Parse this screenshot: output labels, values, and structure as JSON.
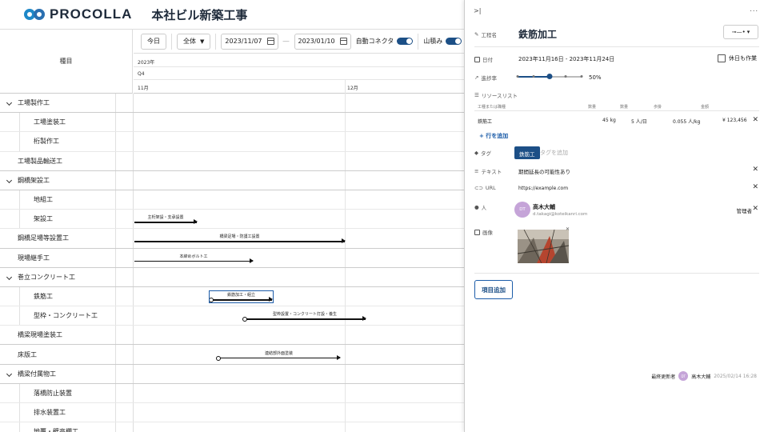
{
  "header": {
    "logo_text": "PROCOLLA",
    "project_title": "本社ビル新築工事"
  },
  "gantt": {
    "column_header": "種目",
    "toolbar": {
      "today": "今日",
      "scope": "全体",
      "start_date": "2023/11/07",
      "end_date": "2023/01/10",
      "auto_connector": "自動コネクタ",
      "stacking": "山積み"
    },
    "timeline": {
      "year": "2023年",
      "quarter": "Q4",
      "months": [
        "11月",
        "12月"
      ]
    },
    "rows": [
      {
        "label": "工場製作工",
        "kind": "parent"
      },
      {
        "label": "工場塗装工",
        "kind": "child"
      },
      {
        "label": "桁製作工",
        "kind": "child"
      },
      {
        "label": "工場製品輸送工",
        "kind": "plain"
      },
      {
        "label": "鋼橋架設工",
        "kind": "parent"
      },
      {
        "label": "地組工",
        "kind": "child"
      },
      {
        "label": "架設工",
        "kind": "child"
      },
      {
        "label": "鋼橋足場等設置工",
        "kind": "plain"
      },
      {
        "label": "現場継手工",
        "kind": "plain"
      },
      {
        "label": "巻立コンクリート工",
        "kind": "parent"
      },
      {
        "label": "鉄筋工",
        "kind": "child"
      },
      {
        "label": "型枠・コンクリート工",
        "kind": "child"
      },
      {
        "label": "橋梁現場塗装工",
        "kind": "plain"
      },
      {
        "label": "床版工",
        "kind": "plain"
      },
      {
        "label": "橋梁付属物工",
        "kind": "parent"
      },
      {
        "label": "落橋防止装置",
        "kind": "child"
      },
      {
        "label": "排水装置工",
        "kind": "child"
      },
      {
        "label": "地覆・壁高欄工",
        "kind": "child"
      }
    ],
    "bars": [
      {
        "row": 6,
        "label": "主桁架設・支承設置"
      },
      {
        "row": 7,
        "label": "橋梁足場・防護工設置"
      },
      {
        "row": 8,
        "label": "本締めボルト工"
      },
      {
        "row": 10,
        "label": "鉄筋加工・組立"
      },
      {
        "row": 11,
        "label": "型枠設置・コンクリート打設・養生"
      },
      {
        "row": 13,
        "label": "連結部外面塗装"
      }
    ]
  },
  "panel": {
    "name_label": "工程名",
    "name_value": "鉄筋加工",
    "date_label": "日付",
    "date_value": "2023年11月16日 - 2023年11月24日",
    "holiday_label": "休日も作業",
    "progress_label": "進捗率",
    "progress_value": "50%",
    "progress_fraction": 0.5,
    "resource_label": "リソースリスト",
    "resource_headers": [
      "工種または職種",
      "数量",
      "数量",
      "歩掛",
      "金額"
    ],
    "resource_row": [
      "鉄筋工",
      "45 kg",
      "5 人/日",
      "0.055 人/kg",
      "¥ 123,456"
    ],
    "add_row": "+ 行を追加",
    "tag_label": "タグ",
    "tag_value": "鉄筋工",
    "tag_placeholder": "タグを追加",
    "text_label": "テキスト",
    "text_value": "期間延長の可能性あり",
    "url_label": "URL",
    "url_value": "https://example.com",
    "person_label": "人",
    "person_initials": "DT",
    "person_name": "高木大輔",
    "person_email": "d.takagi@koteikanri.com",
    "person_role": "管理者",
    "image_label": "画像",
    "add_item": "項目追加",
    "footer_label": "最終更新者",
    "footer_initials": "DT",
    "footer_name": "高木大輔",
    "footer_time": "2025/02/14 16:28",
    "collapse_icon": ">|",
    "more_icon": "..."
  },
  "colors": {
    "accent": "#1c4f86",
    "avatar": "#c5a4d8"
  }
}
